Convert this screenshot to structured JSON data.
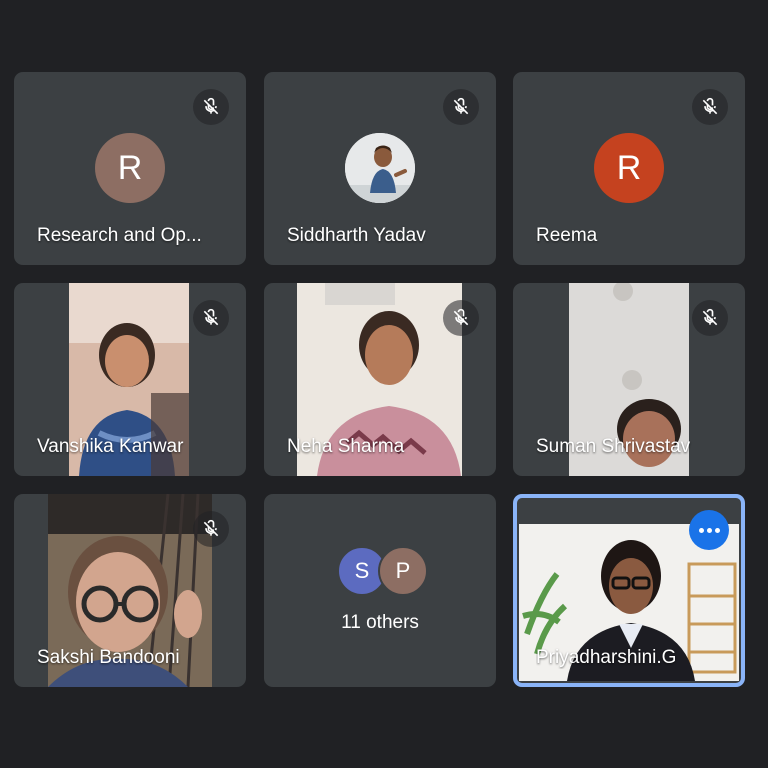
{
  "colors": {
    "background": "#202124",
    "tile": "#3c4043",
    "active_speaker_border": "#8ab4f8",
    "more_button": "#1a73e8"
  },
  "participants": [
    {
      "name": "Research and Op...",
      "avatar_letter": "R",
      "avatar_color": "#8d6e63",
      "muted": true,
      "video": false
    },
    {
      "name": "Siddharth Yadav",
      "avatar_type": "photo",
      "muted": true,
      "video": false
    },
    {
      "name": "Reema",
      "avatar_letter": "R",
      "avatar_color": "#c5421f",
      "muted": true,
      "video": false
    },
    {
      "name": "Vanshika Kanwar",
      "muted": true,
      "video": true
    },
    {
      "name": "Neha Sharma",
      "muted": true,
      "video": true
    },
    {
      "name": "Suman Shrivastav",
      "muted": true,
      "video": true
    },
    {
      "name": "Sakshi Bandooni",
      "muted": true,
      "video": true
    },
    {
      "name": "Priyadharshini.G",
      "muted": false,
      "video": true,
      "active_speaker": true,
      "more_options_icon": "more-horizontal-icon"
    }
  ],
  "others": {
    "label": "11 others",
    "avatars": [
      {
        "letter": "S",
        "color": "#5c6bc0"
      },
      {
        "letter": "P",
        "color": "#8d6e63"
      }
    ]
  },
  "icons": {
    "mute": "mic-off-icon"
  }
}
